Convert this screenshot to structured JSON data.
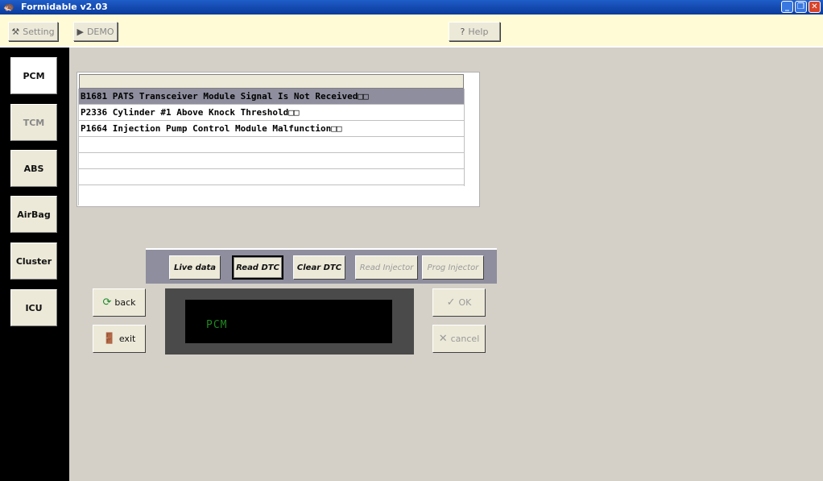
{
  "window": {
    "title": "Formidable v2.03",
    "controls": [
      "_",
      "❐",
      "✕"
    ]
  },
  "toolbar": {
    "setting_label": "Setting",
    "demo_label": "DEMO",
    "help_label": "Help"
  },
  "modules": {
    "items": [
      {
        "label": "PCM"
      },
      {
        "label": "TCM"
      },
      {
        "label": "ABS"
      },
      {
        "label": "AirBag"
      },
      {
        "label": "Cluster"
      },
      {
        "label": "ICU"
      }
    ],
    "active": "PCM"
  },
  "dtc_list": {
    "rows": [
      "B1681 PATS Transceiver Module Signal Is Not Received□□",
      "P2336 Cylinder #1 Above Knock Threshold□□",
      "P1664 Injection Pump Control Module Malfunction□□",
      "",
      "",
      ""
    ],
    "selected_index": 0
  },
  "functions": {
    "live_data": "Live data",
    "read_dtc": "Read DTC",
    "clear_dtc": "Clear DTC",
    "read_injector": "Read Injector",
    "prog_injector": "Prog Injector"
  },
  "nav": {
    "back_label": "back",
    "exit_label": "exit",
    "ok_label": "OK",
    "cancel_label": "cancel"
  },
  "display": {
    "text": "PCM"
  },
  "colors": {
    "toolbar_bg": "#fffbd7",
    "selected_row": "#8e8e9e",
    "display_text": "#1f8a1f"
  }
}
